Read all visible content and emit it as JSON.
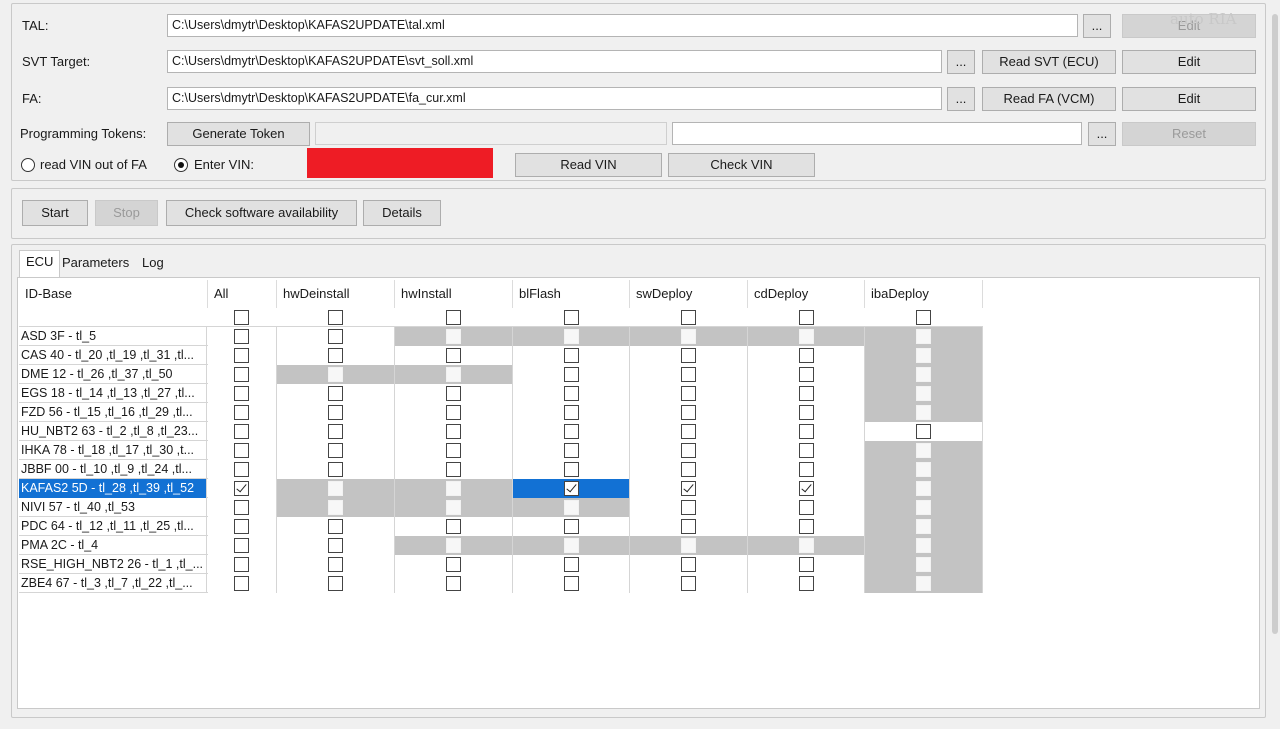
{
  "tal": {
    "label": "TAL:",
    "path": "C:\\Users\\dmytr\\Desktop\\KAFAS2UPDATE\\tal.xml",
    "browse": "...",
    "edit": "Edit"
  },
  "svt": {
    "label": "SVT Target:",
    "path": "C:\\Users\\dmytr\\Desktop\\KAFAS2UPDATE\\svt_soll.xml",
    "browse": "...",
    "read": "Read SVT (ECU)",
    "edit": "Edit"
  },
  "fa": {
    "label": "FA:",
    "path": "C:\\Users\\dmytr\\Desktop\\KAFAS2UPDATE\\fa_cur.xml",
    "browse": "...",
    "read": "Read FA (VCM)",
    "edit": "Edit"
  },
  "tokens": {
    "label": "Programming Tokens:",
    "generate": "Generate Token",
    "field1": "",
    "field2": "",
    "browse": "...",
    "reset": "Reset"
  },
  "vin": {
    "radio_fa": "read VIN out of FA",
    "radio_enter": "Enter VIN:",
    "read": "Read VIN",
    "check": "Check VIN",
    "redacted_color": "#ee1c25"
  },
  "actions": {
    "start": "Start",
    "stop": "Stop",
    "check_sw": "Check software availability",
    "details": "Details"
  },
  "tabs": [
    "ECU",
    "Parameters",
    "Log"
  ],
  "watermark": "auto RIA",
  "grid": {
    "columns": [
      "ID-Base",
      "All",
      "hwDeinstall",
      "hwInstall",
      "blFlash",
      "swDeploy",
      "cdDeploy",
      "ibaDeploy"
    ],
    "rows": [
      {
        "name": "ASD 3F - tl_5",
        "gray": [
          0,
          0,
          1,
          1,
          1,
          1,
          1
        ],
        "checked": [
          0,
          0,
          0,
          0,
          0,
          0,
          0
        ]
      },
      {
        "name": "CAS 40 - tl_20 ,tl_19 ,tl_31 ,tl...",
        "gray": [
          0,
          0,
          0,
          0,
          0,
          0,
          1
        ],
        "checked": [
          0,
          0,
          0,
          0,
          0,
          0,
          0
        ]
      },
      {
        "name": "DME 12 - tl_26 ,tl_37 ,tl_50",
        "gray": [
          0,
          1,
          1,
          0,
          0,
          0,
          1
        ],
        "checked": [
          0,
          0,
          0,
          0,
          0,
          0,
          0
        ]
      },
      {
        "name": "EGS 18 - tl_14 ,tl_13 ,tl_27 ,tl...",
        "gray": [
          0,
          0,
          0,
          0,
          0,
          0,
          1
        ],
        "checked": [
          0,
          0,
          0,
          0,
          0,
          0,
          0
        ]
      },
      {
        "name": "FZD 56 - tl_15 ,tl_16 ,tl_29 ,tl...",
        "gray": [
          0,
          0,
          0,
          0,
          0,
          0,
          1
        ],
        "checked": [
          0,
          0,
          0,
          0,
          0,
          0,
          0
        ]
      },
      {
        "name": "HU_NBT2 63 - tl_2 ,tl_8 ,tl_23...",
        "gray": [
          0,
          0,
          0,
          0,
          0,
          0,
          0
        ],
        "checked": [
          0,
          0,
          0,
          0,
          0,
          0,
          0
        ]
      },
      {
        "name": "IHKA 78 - tl_18 ,tl_17 ,tl_30 ,t...",
        "gray": [
          0,
          0,
          0,
          0,
          0,
          0,
          1
        ],
        "checked": [
          0,
          0,
          0,
          0,
          0,
          0,
          0
        ]
      },
      {
        "name": "JBBF 00 - tl_10 ,tl_9 ,tl_24 ,tl...",
        "gray": [
          0,
          0,
          0,
          0,
          0,
          0,
          1
        ],
        "checked": [
          0,
          0,
          0,
          0,
          0,
          0,
          0
        ]
      },
      {
        "name": "KAFAS2 5D - tl_28 ,tl_39 ,tl_52",
        "gray": [
          0,
          1,
          1,
          0,
          0,
          0,
          1
        ],
        "checked": [
          1,
          0,
          0,
          1,
          1,
          1,
          0
        ],
        "selected": true
      },
      {
        "name": "NIVI 57 - tl_40 ,tl_53",
        "gray": [
          0,
          1,
          1,
          1,
          0,
          0,
          1
        ],
        "checked": [
          0,
          0,
          0,
          0,
          0,
          0,
          0
        ]
      },
      {
        "name": "PDC 64 - tl_12 ,tl_11 ,tl_25 ,tl...",
        "gray": [
          0,
          0,
          0,
          0,
          0,
          0,
          1
        ],
        "checked": [
          0,
          0,
          0,
          0,
          0,
          0,
          0
        ]
      },
      {
        "name": "PMA 2C - tl_4",
        "gray": [
          0,
          0,
          1,
          1,
          1,
          1,
          1
        ],
        "checked": [
          0,
          0,
          0,
          0,
          0,
          0,
          0
        ]
      },
      {
        "name": "RSE_HIGH_NBT2 26 - tl_1 ,tl_...",
        "gray": [
          0,
          0,
          0,
          0,
          0,
          0,
          1
        ],
        "checked": [
          0,
          0,
          0,
          0,
          0,
          0,
          0
        ]
      },
      {
        "name": "ZBE4 67 - tl_3 ,tl_7 ,tl_22 ,tl_...",
        "gray": [
          0,
          0,
          0,
          0,
          0,
          0,
          1
        ],
        "checked": [
          0,
          0,
          0,
          0,
          0,
          0,
          0
        ]
      }
    ]
  }
}
